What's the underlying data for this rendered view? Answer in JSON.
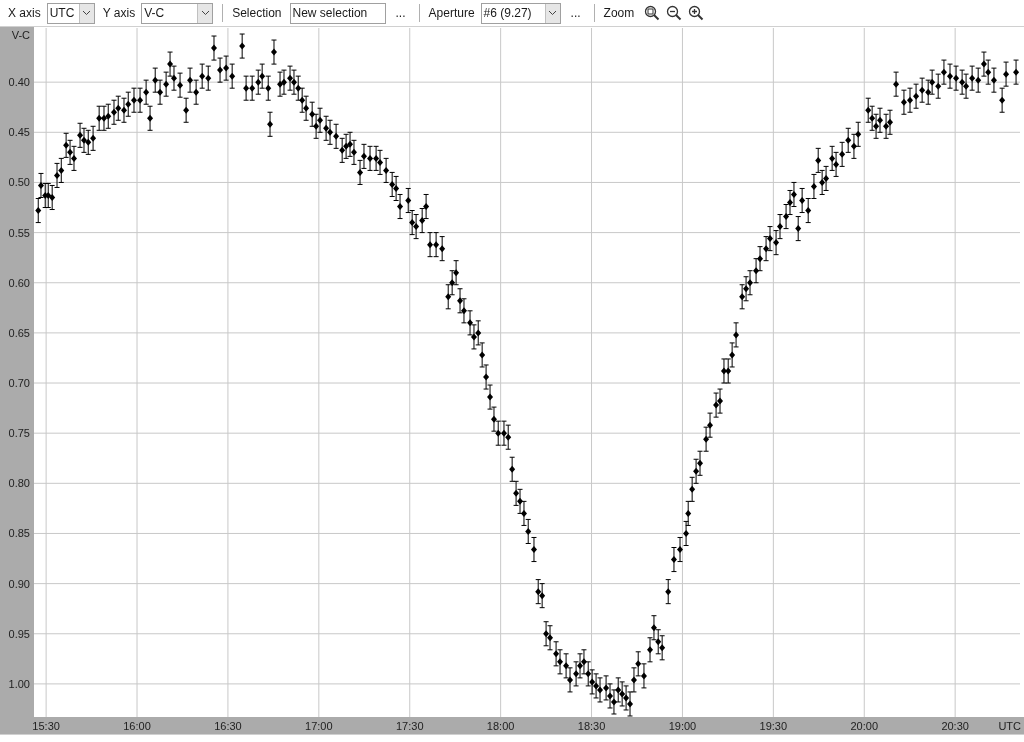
{
  "toolbar": {
    "x_axis": {
      "label": "X axis",
      "value": "UTC"
    },
    "y_axis": {
      "label": "Y axis",
      "value": "V-C"
    },
    "selection": {
      "label": "Selection",
      "value": "New selection",
      "more": "..."
    },
    "aperture": {
      "label": "Aperture",
      "value": "#6 (9.27)",
      "more": "..."
    },
    "zoom": {
      "label": "Zoom"
    }
  },
  "plot": {
    "chart_data": {
      "type": "scatter",
      "xlabel": "UTC",
      "ylabel": "V-C",
      "xlim": [
        926,
        1251.4
      ],
      "ylim": [
        1.033,
        0.346
      ],
      "grid": true,
      "xticks": [
        {
          "value": 930,
          "label": "15:30"
        },
        {
          "value": 960,
          "label": "16:00"
        },
        {
          "value": 990,
          "label": "16:30"
        },
        {
          "value": 1020,
          "label": "17:00"
        },
        {
          "value": 1050,
          "label": "17:30"
        },
        {
          "value": 1080,
          "label": "18:00"
        },
        {
          "value": 1110,
          "label": "18:30"
        },
        {
          "value": 1140,
          "label": "19:00"
        },
        {
          "value": 1170,
          "label": "19:30"
        },
        {
          "value": 1200,
          "label": "20:00"
        },
        {
          "value": 1230,
          "label": "20:30"
        }
      ],
      "yticks": [
        {
          "value": 0.4,
          "label": "0.40"
        },
        {
          "value": 0.45,
          "label": "0.45"
        },
        {
          "value": 0.5,
          "label": "0.50"
        },
        {
          "value": 0.55,
          "label": "0.55"
        },
        {
          "value": 0.6,
          "label": "0.60"
        },
        {
          "value": 0.65,
          "label": "0.65"
        },
        {
          "value": 0.7,
          "label": "0.70"
        },
        {
          "value": 0.75,
          "label": "0.75"
        },
        {
          "value": 0.8,
          "label": "0.80"
        },
        {
          "value": 0.85,
          "label": "0.85"
        },
        {
          "value": 0.9,
          "label": "0.90"
        },
        {
          "value": 0.95,
          "label": "0.95"
        },
        {
          "value": 1.0,
          "label": "1.00"
        }
      ],
      "x": [
        927.4,
        928.3,
        929.7,
        930.7,
        932.0,
        933.6,
        935.0,
        936.6,
        937.9,
        939.2,
        941.2,
        942.5,
        943.9,
        945.5,
        947.5,
        949.1,
        950.5,
        952.4,
        953.8,
        955.7,
        957.1,
        959.0,
        961.0,
        963.0,
        964.3,
        966.0,
        967.6,
        969.6,
        970.9,
        972.2,
        974.2,
        976.2,
        977.5,
        979.5,
        981.5,
        983.5,
        985.4,
        987.4,
        989.4,
        991.4,
        994.7,
        996.0,
        998.0,
        1000.0,
        1001.3,
        1003.3,
        1003.9,
        1005.2,
        1007.2,
        1008.5,
        1010.5,
        1011.8,
        1013.2,
        1014.5,
        1015.8,
        1017.8,
        1019.1,
        1020.4,
        1022.4,
        1023.7,
        1025.7,
        1027.7,
        1029.0,
        1030.3,
        1031.6,
        1033.6,
        1034.9,
        1036.9,
        1038.9,
        1040.2,
        1042.2,
        1044.2,
        1045.5,
        1046.8,
        1049.5,
        1050.8,
        1052.1,
        1054.1,
        1055.4,
        1056.7,
        1058.7,
        1060.7,
        1062.7,
        1064.0,
        1065.3,
        1066.6,
        1067.9,
        1069.9,
        1071.2,
        1072.6,
        1073.9,
        1075.2,
        1076.5,
        1077.8,
        1079.2,
        1081.1,
        1082.5,
        1083.8,
        1085.1,
        1086.4,
        1087.7,
        1089.1,
        1091.0,
        1092.4,
        1093.7,
        1095.0,
        1096.3,
        1098.3,
        1099.6,
        1101.6,
        1102.9,
        1104.9,
        1106.2,
        1107.5,
        1108.9,
        1110.2,
        1111.5,
        1112.8,
        1114.8,
        1116.1,
        1117.4,
        1118.8,
        1120.1,
        1121.4,
        1122.7,
        1124.0,
        1125.4,
        1127.3,
        1129.3,
        1130.6,
        1132.0,
        1133.3,
        1135.3,
        1137.2,
        1139.2,
        1141.2,
        1141.9,
        1143.2,
        1144.5,
        1145.8,
        1147.8,
        1149.1,
        1151.1,
        1152.4,
        1153.7,
        1155.1,
        1156.4,
        1157.7,
        1159.7,
        1161.0,
        1162.3,
        1164.3,
        1165.6,
        1167.6,
        1168.9,
        1170.9,
        1172.2,
        1174.2,
        1175.5,
        1176.8,
        1178.2,
        1179.5,
        1181.5,
        1183.4,
        1184.8,
        1186.1,
        1187.4,
        1189.4,
        1190.7,
        1192.7,
        1194.7,
        1196.6,
        1198.0,
        1201.3,
        1202.6,
        1203.9,
        1205.2,
        1207.2,
        1208.5,
        1210.5,
        1213.1,
        1215.1,
        1217.1,
        1219.1,
        1221.1,
        1222.4,
        1224.4,
        1226.3,
        1228.3,
        1230.3,
        1232.3,
        1233.6,
        1235.6,
        1237.6,
        1239.5,
        1240.9,
        1242.8,
        1245.5,
        1246.8,
        1250.1
      ],
      "series": [
        {
          "color": "#000000",
          "errors": [
            0.012,
            0.012,
            0.012,
            0.012,
            0.012,
            0.012,
            0.012,
            0.012,
            0.012,
            0.012,
            0.012,
            0.012,
            0.012,
            0.012,
            0.012,
            0.012,
            0.012,
            0.012,
            0.012,
            0.012,
            0.012,
            0.012,
            0.012,
            0.012,
            0.012,
            0.012,
            0.012,
            0.012,
            0.012,
            0.012,
            0.012,
            0.012,
            0.012,
            0.012,
            0.012,
            0.012,
            0.012,
            0.012,
            0.012,
            0.012,
            0.012,
            0.012,
            0.012,
            0.012,
            0.012,
            0.012,
            0.012,
            0.012,
            0.012,
            0.012,
            0.012,
            0.012,
            0.012,
            0.012,
            0.012,
            0.012,
            0.012,
            0.012,
            0.012,
            0.012,
            0.012,
            0.012,
            0.012,
            0.012,
            0.012,
            0.012,
            0.012,
            0.012,
            0.012,
            0.012,
            0.012,
            0.012,
            0.012,
            0.012,
            0.012,
            0.012,
            0.012,
            0.012,
            0.012,
            0.012,
            0.012,
            0.012,
            0.012,
            0.012,
            0.012,
            0.012,
            0.012,
            0.012,
            0.012,
            0.012,
            0.012,
            0.012,
            0.012,
            0.012,
            0.012,
            0.012,
            0.012,
            0.012,
            0.012,
            0.012,
            0.012,
            0.012,
            0.012,
            0.012,
            0.012,
            0.012,
            0.012,
            0.012,
            0.012,
            0.012,
            0.012,
            0.012,
            0.012,
            0.012,
            0.012,
            0.012,
            0.012,
            0.012,
            0.012,
            0.012,
            0.012,
            0.012,
            0.012,
            0.012,
            0.012,
            0.012,
            0.012,
            0.012,
            0.012,
            0.012,
            0.012,
            0.012,
            0.012,
            0.012,
            0.012,
            0.012,
            0.012,
            0.012,
            0.012,
            0.012,
            0.012,
            0.012,
            0.012,
            0.012,
            0.012,
            0.012,
            0.012,
            0.012,
            0.012,
            0.012,
            0.012,
            0.012,
            0.012,
            0.012,
            0.012,
            0.012,
            0.012,
            0.012,
            0.012,
            0.012,
            0.012,
            0.012,
            0.012,
            0.012,
            0.012,
            0.012,
            0.012,
            0.012,
            0.012,
            0.012,
            0.012,
            0.012,
            0.012,
            0.012,
            0.012,
            0.012,
            0.012,
            0.012,
            0.012,
            0.012,
            0.012,
            0.012,
            0.012,
            0.012,
            0.012,
            0.012,
            0.012,
            0.012,
            0.012,
            0.012,
            0.012,
            0.012,
            0.012,
            0.012,
            0.012,
            0.012,
            0.012,
            0.012,
            0.012,
            0.012
          ],
          "values": [
            0.528,
            0.503,
            0.513,
            0.513,
            0.515,
            0.493,
            0.488,
            0.463,
            0.47,
            0.476,
            0.453,
            0.458,
            0.46,
            0.456,
            0.436,
            0.436,
            0.434,
            0.43,
            0.426,
            0.428,
            0.422,
            0.418,
            0.418,
            0.41,
            0.436,
            0.398,
            0.41,
            0.402,
            0.382,
            0.396,
            0.403,
            0.428,
            0.398,
            0.41,
            0.394,
            0.396,
            0.366,
            0.388,
            0.386,
            0.394,
            0.364,
            0.406,
            0.406,
            0.4,
            0.394,
            0.406,
            0.442,
            0.37,
            0.402,
            0.4,
            0.396,
            0.4,
            0.406,
            0.418,
            0.426,
            0.432,
            0.444,
            0.438,
            0.446,
            0.45,
            0.454,
            0.468,
            0.464,
            0.462,
            0.47,
            0.49,
            0.474,
            0.476,
            0.476,
            0.48,
            0.488,
            0.502,
            0.506,
            0.524,
            0.518,
            0.54,
            0.544,
            0.538,
            0.524,
            0.562,
            0.562,
            0.566,
            0.614,
            0.6,
            0.59,
            0.618,
            0.628,
            0.64,
            0.654,
            0.65,
            0.672,
            0.694,
            0.714,
            0.736,
            0.75,
            0.75,
            0.754,
            0.786,
            0.81,
            0.818,
            0.83,
            0.848,
            0.866,
            0.908,
            0.912,
            0.95,
            0.954,
            0.97,
            0.978,
            0.982,
            0.996,
            0.99,
            0.982,
            0.978,
            0.99,
            0.998,
            1.002,
            1.006,
            1.004,
            1.012,
            1.018,
            1.006,
            1.01,
            1.014,
            1.02,
            0.996,
            0.98,
            0.992,
            0.966,
            0.944,
            0.958,
            0.964,
            0.908,
            0.876,
            0.866,
            0.85,
            0.83,
            0.806,
            0.788,
            0.78,
            0.756,
            0.742,
            0.722,
            0.718,
            0.688,
            0.688,
            0.672,
            0.652,
            0.614,
            0.606,
            0.6,
            0.588,
            0.576,
            0.566,
            0.556,
            0.56,
            0.544,
            0.534,
            0.52,
            0.512,
            0.546,
            0.518,
            0.528,
            0.504,
            0.478,
            0.5,
            0.496,
            0.476,
            0.482,
            0.472,
            0.458,
            0.464,
            0.452,
            0.428,
            0.436,
            0.444,
            0.438,
            0.444,
            0.44,
            0.402,
            0.42,
            0.418,
            0.414,
            0.408,
            0.41,
            0.4,
            0.404,
            0.39,
            0.394,
            0.396,
            0.4,
            0.404,
            0.396,
            0.398,
            0.382,
            0.39,
            0.398,
            0.418,
            0.392,
            0.39
          ]
        }
      ]
    }
  }
}
